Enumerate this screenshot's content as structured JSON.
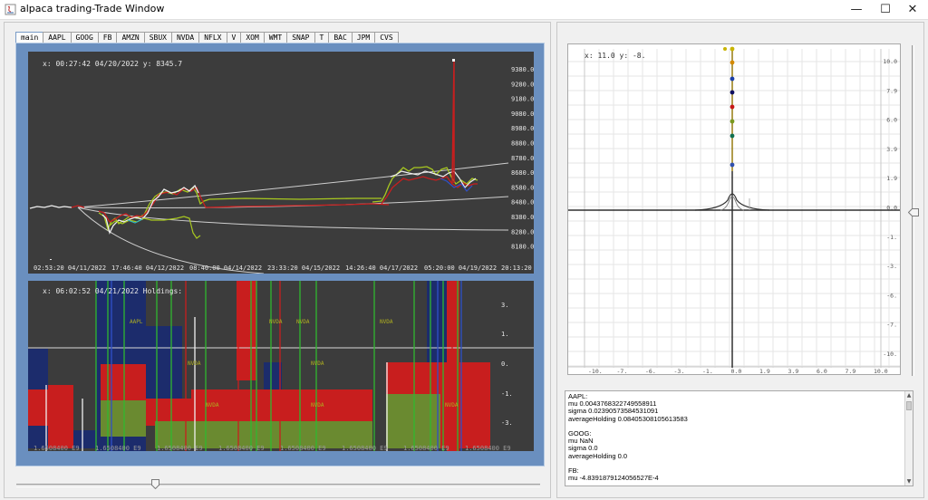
{
  "window": {
    "title": "alpaca trading-Trade Window",
    "minimize": "—",
    "maximize": "☐",
    "close": "✕"
  },
  "tabs": [
    "main",
    "AAPL",
    "GOOG",
    "FB",
    "AMZN",
    "SBUX",
    "NVDA",
    "NFLX",
    "V",
    "XOM",
    "WMT",
    "SNAP",
    "T",
    "BAC",
    "JPM",
    "CVS"
  ],
  "active_tab": "main",
  "price_chart": {
    "readout": "x: 00:27:42 04/20/2022    y: 8345.7",
    "y_ticks": [
      "9380.0",
      "9280.0",
      "9180.0",
      "9080.0",
      "8980.0",
      "8880.0",
      "8780.0",
      "8680.0",
      "8580.0",
      "8480.0",
      "8380.0",
      "8280.0",
      "8180.0"
    ],
    "x_ticks": [
      "02:53:20 04/11/2022",
      "17:46:40 04/12/2022",
      "08:40:00 04/14/2022",
      "23:33:20 04/15/2022",
      "14:26:40 04/17/2022",
      "05:20:00 04/19/2022",
      "20:13:20"
    ]
  },
  "holdings_chart": {
    "readout": "x: 06:02:52 04/21/2022    Holdings:",
    "y_ticks": [
      "3.",
      "1.",
      "0.",
      "-1.",
      "-3."
    ],
    "x_tick": "1.6508400 E9",
    "labels": [
      "AAPL",
      "NVDA",
      "NVDA",
      "NVDA",
      "NVDA",
      "NVDA",
      "NVDA",
      "NVDA",
      "NVDA"
    ]
  },
  "distribution_chart": {
    "readout": "x: 11.0    y: -8.",
    "y_ticks": [
      "10.0",
      "7.9",
      "6.0",
      "3.9",
      "1.9",
      "0.0",
      "-1.",
      "-3.",
      "-6.",
      "-7.",
      "-10."
    ],
    "x_ticks": [
      "-10.",
      "-7.",
      "-6.",
      "-3.",
      "-1.",
      "0.0",
      "1.9",
      "3.9",
      "6.0",
      "7.9",
      "10.0"
    ],
    "dot_colors": [
      "#c8b400",
      "#d48a00",
      "#1a3fa8",
      "#101060",
      "#c81818",
      "#7a9a20",
      "#107050",
      "#3050b0"
    ]
  },
  "stats_text": [
    "AAPL:",
    "mu 0.0043768322749558911",
    "sigma 0.02390573584531091",
    "averageHolding 0.08405308105613583",
    "",
    "GOOG:",
    "mu NaN",
    "sigma 0.0",
    "averageHolding 0.0",
    "",
    "FB:",
    "mu -4.8391879124056527E-4"
  ],
  "colors": {
    "chart_bg": "#3c3c3c",
    "frame_blue": "#6a8fbf",
    "white_line": "#f0f0f0",
    "green": "#2fb82f",
    "red": "#c81e1e",
    "yellow": "#a8c820",
    "navy": "#1c2c6c"
  }
}
